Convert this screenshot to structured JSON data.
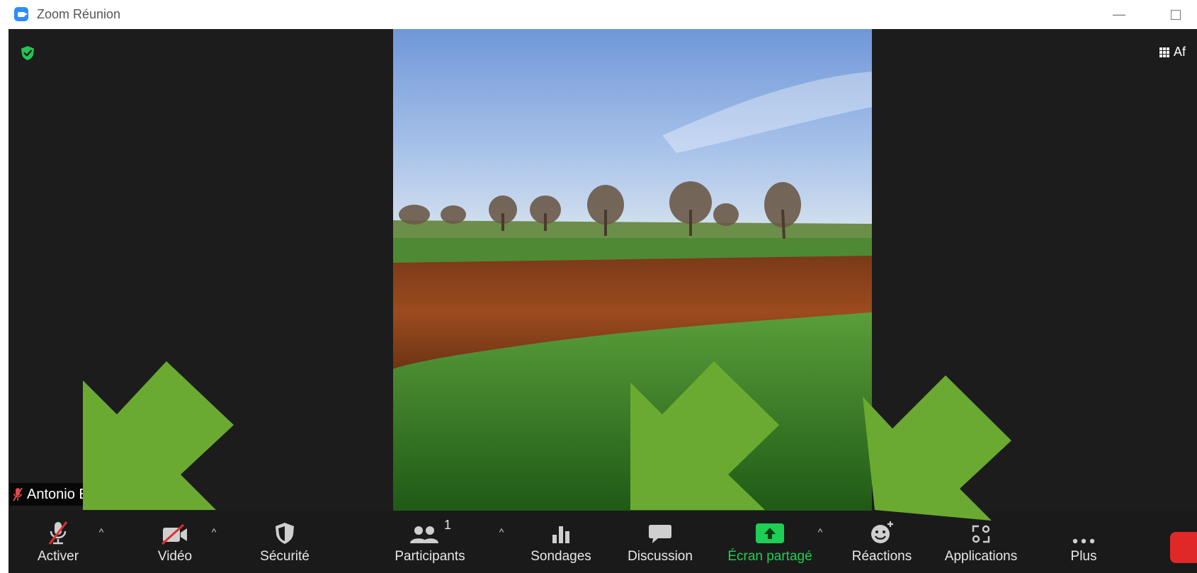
{
  "window": {
    "title": "Zoom Réunion",
    "app_icon": "zoom-camera-icon",
    "minimize_glyph": "—"
  },
  "meeting": {
    "security_badge_icon": "green-shield-check-icon",
    "view_button_label": "Af",
    "view_icon": "grid-icon",
    "participant_name": "Antonio BISPO_...",
    "participant_muted": true
  },
  "toolbar": {
    "mute": {
      "label": "Activer",
      "icon": "mic-muted-icon"
    },
    "video": {
      "label": "Vidéo",
      "icon": "camera-off-icon"
    },
    "security": {
      "label": "Sécurité",
      "icon": "shield-icon"
    },
    "participants": {
      "label": "Participants",
      "icon": "people-icon",
      "count": "1"
    },
    "polls": {
      "label": "Sondages",
      "icon": "bar-chart-icon"
    },
    "chat": {
      "label": "Discussion",
      "icon": "chat-bubble-icon"
    },
    "share": {
      "label": "Écran partagé",
      "icon": "share-screen-up-arrow-icon",
      "color": "#1fcf55"
    },
    "reactions": {
      "label": "Réactions",
      "icon": "smiley-plus-icon"
    },
    "apps": {
      "label": "Applications",
      "icon": "apps-icon"
    },
    "more": {
      "label": "Plus",
      "icon": "ellipsis-icon"
    },
    "caret_glyph": "^"
  },
  "colors": {
    "meeting_bg": "#1c1c1c",
    "toolbar_bg": "#1a1a1a",
    "share_green": "#1fcf55",
    "end_red": "#e02828",
    "annotation_arrow": "#6aaa30"
  }
}
